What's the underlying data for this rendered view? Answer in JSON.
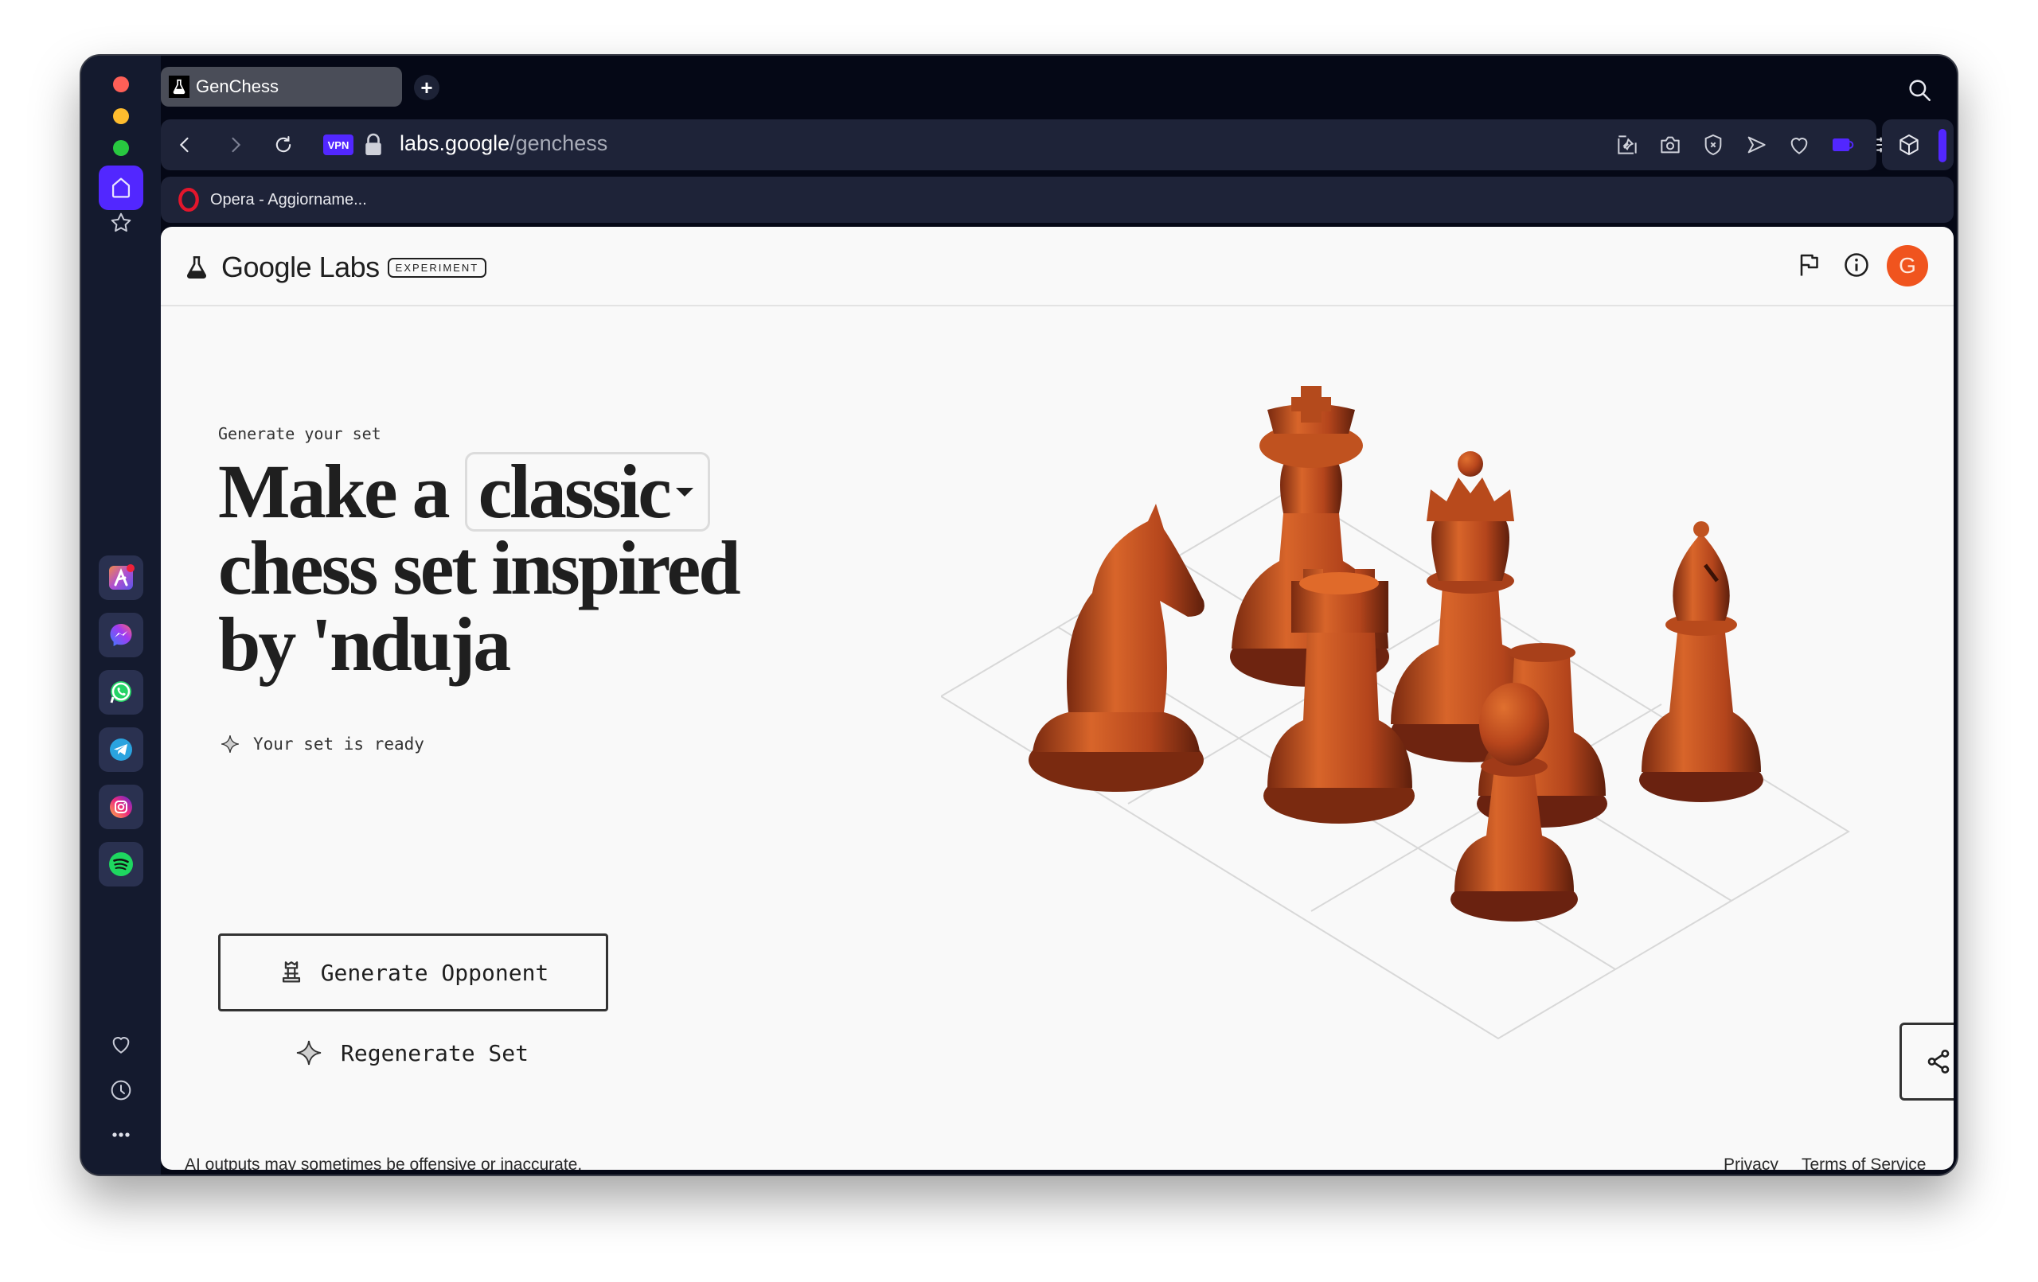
{
  "browser": {
    "tab_title": "GenChess",
    "new_tab_label": "+",
    "url_host": "labs.google",
    "url_path": "/genchess",
    "vpn_label": "VPN",
    "bookmark_label": "Opera - Aggiorname...",
    "extensions": [
      "pin-icon",
      "camera-icon",
      "shield-x-icon",
      "send-icon",
      "heart-icon",
      "battery-icon",
      "sliders-icon",
      "user-icon"
    ],
    "accent_color": "#5227ff"
  },
  "sidebar": {
    "top_items": [
      "home",
      "bookmarks"
    ],
    "apps": [
      "aria",
      "messenger",
      "whatsapp",
      "telegram",
      "instagram",
      "spotify"
    ],
    "bottom_items": [
      "favorites",
      "history",
      "more"
    ]
  },
  "header": {
    "brand": "Google Labs",
    "badge": "EXPERIMENT",
    "avatar_initial": "G",
    "avatar_color": "#f0541e"
  },
  "main": {
    "eyebrow": "Generate your set",
    "headline_prefix": "Make a",
    "style_selected": "classic",
    "headline_line2": "chess set inspired",
    "headline_line3": "by 'nduja",
    "status": "Your set is ready",
    "generate_button": "Generate Opponent",
    "regenerate_button": "Regenerate Set"
  },
  "footer": {
    "disclaimer": "AI outputs may sometimes be offensive or inaccurate.",
    "privacy": "Privacy",
    "terms": "Terms of Service"
  }
}
